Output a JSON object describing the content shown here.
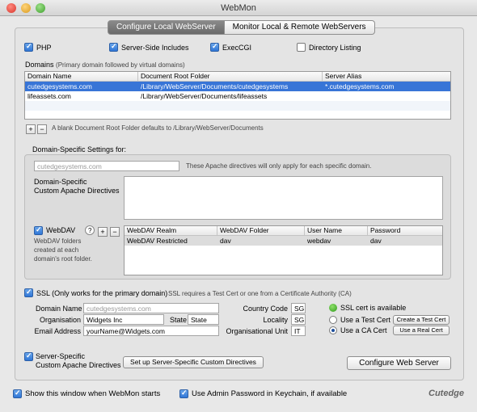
{
  "window": {
    "title": "WebMon"
  },
  "tabs": [
    "Configure Local WebServer",
    "Monitor Local & Remote WebServers"
  ],
  "modules": {
    "php": "PHP",
    "ssi": "Server-Side Includes",
    "execcgi": "ExecCGI",
    "dirlist": "Directory Listing"
  },
  "domains": {
    "label": "Domains",
    "hint": "(Primary domain followed by virtual domains)",
    "headers": [
      "Domain Name",
      "Document Root Folder",
      "Server Alias"
    ],
    "rows": [
      [
        "cutedgesystems.com",
        "/Library/WebServer/Documents/cutedgesystems",
        "*.cutedgesystems.com"
      ],
      [
        "lifeassets.com",
        "/Library/WebServer/Documents/lifeassets",
        ""
      ]
    ],
    "note": "A blank Document Root Folder defaults to /Library/WebServer/Documents"
  },
  "domain_settings": {
    "title": "Domain-Specific Settings for:",
    "domain_placeholder": "cutedgesystems.com",
    "note": "These Apache directives will only apply for each specific domain.",
    "directives_label_1": "Domain-Specific",
    "directives_label_2": "Custom Apache Directives"
  },
  "webdav": {
    "label": "WebDAV",
    "help": "?",
    "desc_1": "WebDAV folders",
    "desc_2": "created at each",
    "desc_3": "domain's root folder.",
    "headers": [
      "WebDAV Realm",
      "WebDAV Folder",
      "User Name",
      "Password"
    ],
    "rows": [
      [
        "WebDAV Restricted",
        "dav",
        "webdav",
        "dav"
      ]
    ]
  },
  "ssl": {
    "label": "SSL (Only works for the primary domain)",
    "note": "SSL requires a Test Cert or one from a Certificate Authority (CA)",
    "domain_label": "Domain Name",
    "domain_placeholder": "cutedgesystems.com",
    "org_label": "Organisation",
    "org_value": "Widgets Inc",
    "state_label": "State",
    "state_value": "State",
    "email_label": "Email Address",
    "email_value": "yourName@Widgets.com",
    "country_label": "Country Code",
    "country_value": "SG",
    "locality_label": "Locality",
    "locality_value": "SG",
    "unit_label": "Organisational Unit",
    "unit_value": "IT",
    "status": "SSL cert is available",
    "test_cert": "Use a Test Cert",
    "ca_cert": "Use a CA Cert",
    "create_test": "Create a Test Cert",
    "use_real": "Use a Real Cert"
  },
  "server_specific": {
    "label_1": "Server-Specific",
    "label_2": "Custom Apache Directives",
    "setup_button": "Set up Server-Specific Custom Directives",
    "configure_button": "Configure Web Server"
  },
  "footer": {
    "show_window": "Show this window when WebMon starts",
    "keychain": "Use Admin Password in Keychain, if available",
    "logo": "Cutedge"
  }
}
